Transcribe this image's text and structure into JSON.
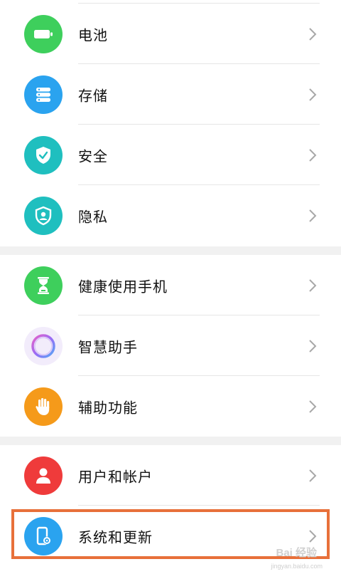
{
  "colors": {
    "battery": "#3ecf5c",
    "storage": "#2aa3ef",
    "security": "#1fbfbf",
    "privacy": "#1fbfbf",
    "health": "#3ecf5c",
    "assistant_ring": "#b77cf0",
    "accessibility": "#f59a1a",
    "account": "#ef3b3b",
    "system": "#2aa3ef",
    "highlight_border": "#e8703a"
  },
  "groups": [
    {
      "items": [
        {
          "label": "电池",
          "icon": "battery-icon"
        },
        {
          "label": "存储",
          "icon": "storage-icon"
        },
        {
          "label": "安全",
          "icon": "shield-check-icon"
        },
        {
          "label": "隐私",
          "icon": "privacy-shield-icon"
        }
      ]
    },
    {
      "items": [
        {
          "label": "健康使用手机",
          "icon": "hourglass-icon"
        },
        {
          "label": "智慧助手",
          "icon": "assistant-ring-icon"
        },
        {
          "label": "辅助功能",
          "icon": "hand-icon"
        }
      ]
    },
    {
      "items": [
        {
          "label": "用户和帐户",
          "icon": "user-icon"
        },
        {
          "label": "系统和更新",
          "icon": "phone-settings-icon"
        }
      ]
    }
  ],
  "watermark": {
    "text": "Bai 经验",
    "sub": "jingyan.baidu.com"
  }
}
